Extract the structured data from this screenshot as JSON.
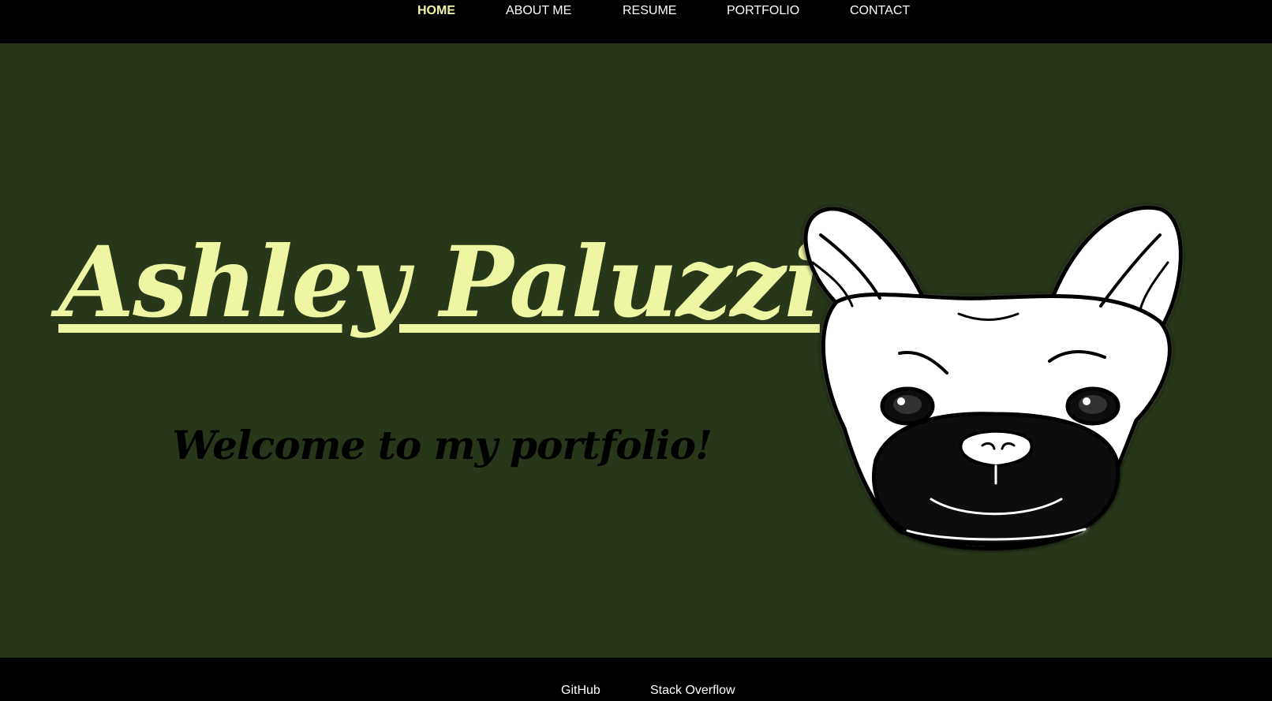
{
  "nav": {
    "items": [
      {
        "label": "HOME",
        "active": true
      },
      {
        "label": "ABOUT ME",
        "active": false
      },
      {
        "label": "RESUME",
        "active": false
      },
      {
        "label": "PORTFOLIO",
        "active": false
      },
      {
        "label": "CONTACT",
        "active": false
      }
    ]
  },
  "hero": {
    "name": "Ashley Paluzzi",
    "welcome": "Welcome to my portfolio!",
    "image_icon": "french-bulldog-illustration"
  },
  "footer": {
    "links": [
      {
        "label": "GitHub"
      },
      {
        "label": "Stack Overflow"
      }
    ]
  },
  "colors": {
    "page_background": "#000000",
    "hero_background": "#28361a",
    "accent": "#eef5a3",
    "nav_text": "#ffffff"
  }
}
